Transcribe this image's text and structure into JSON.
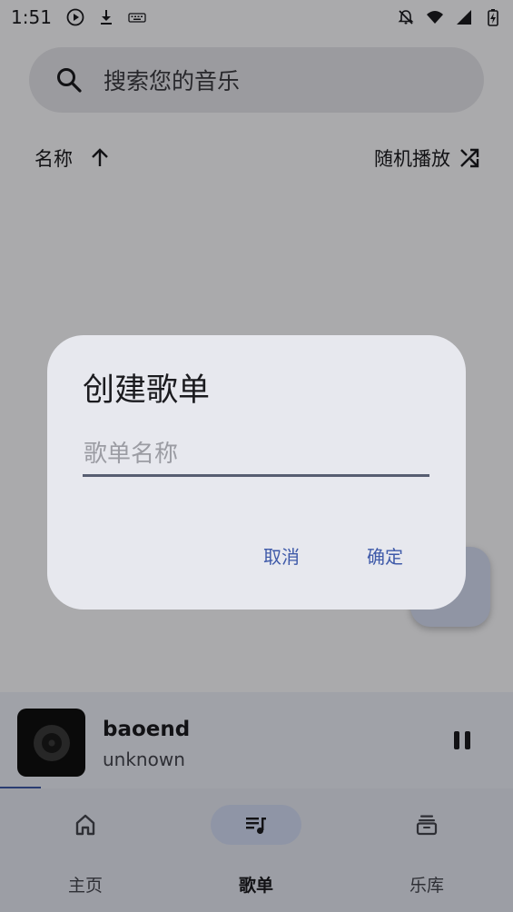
{
  "status_bar": {
    "time": "1:51",
    "icons_left": [
      "play-circle-icon",
      "download-icon",
      "keyboard-icon"
    ],
    "icons_right": [
      "notifications-off-icon",
      "wifi-icon",
      "signal-icon",
      "battery-charging-icon"
    ]
  },
  "search": {
    "placeholder": "搜索您的音乐",
    "icon": "search-icon"
  },
  "sort": {
    "label": "名称",
    "direction_icon": "arrow-up-icon",
    "shuffle_label": "随机播放",
    "shuffle_icon": "shuffle-icon"
  },
  "dialog": {
    "title": "创建歌单",
    "input_placeholder": "歌单名称",
    "input_value": "",
    "cancel_label": "取消",
    "confirm_label": "确定"
  },
  "mini_player": {
    "title": "baoend",
    "artist": "unknown",
    "progress": 0.08,
    "pause_icon": "pause-icon",
    "art_icon": "vinyl-record-icon"
  },
  "bottom_nav": {
    "items": [
      {
        "label": "主页",
        "icon": "home-icon",
        "active": false
      },
      {
        "label": "歌单",
        "icon": "playlist-icon",
        "active": true
      },
      {
        "label": "乐库",
        "icon": "library-icon",
        "active": false
      }
    ]
  },
  "colors": {
    "accent": "#3f5aa9",
    "active_pill": "#d3dcf5",
    "dialog_bg": "#e7e8ee"
  }
}
